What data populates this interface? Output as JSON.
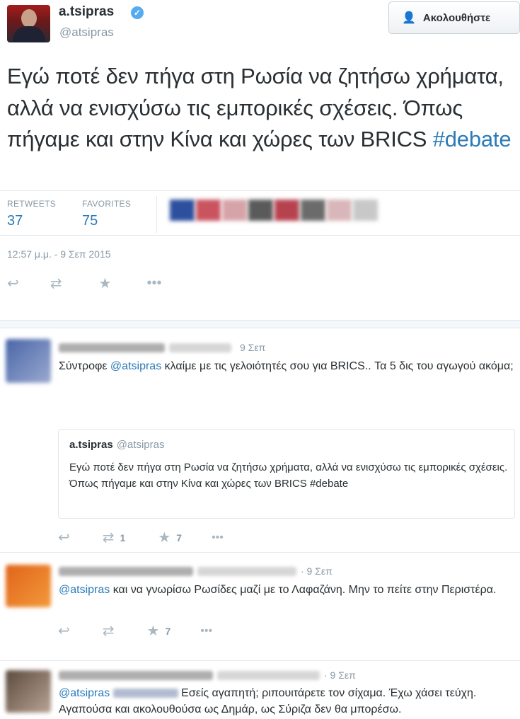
{
  "main_tweet": {
    "display_name": "a.tsipras",
    "screen_name": "@atsipras",
    "follow_label": "Ακολουθήστε",
    "text": "Εγώ ποτέ δεν πήγα στη Ρωσία να ζητήσω χρήματα, αλλά να ενισχύσω τις εμπορικές σχέσεις. Όπως πήγαμε και στην Κίνα και χώρες των BRICS",
    "hashtag": "#debate",
    "retweets_label": "RETWEETS",
    "retweets_count": "37",
    "favorites_label": "FAVORITES",
    "favorites_count": "75",
    "timestamp": "12:57 μ.μ. - 9 Σεπ 2015",
    "icons": {
      "reply": "reply-icon",
      "retweet": "retweet-icon",
      "favorite": "star-icon",
      "more": "more-icon"
    }
  },
  "replies": [
    {
      "time": "9 Σεπ",
      "mention": "@atsipras",
      "text_before": "Σύντροφε ",
      "text_after": " κλαίμε με τις γελοιότητές σου για BRICS.. Τα 5 δις του αγωγού ακόμα;",
      "quote": {
        "display_name": "a.tsipras",
        "screen_name": "@atsipras",
        "text": "Εγώ ποτέ δεν πήγα στη Ρωσία να ζητήσω χρήματα, αλλά να ενισχύσω τις εμπορικές σχέσεις. Όπως πήγαμε και στην Κίνα και χώρες των BRICS #debate"
      },
      "retweet_count": "1",
      "favorite_count": "7"
    },
    {
      "time": "· 9 Σεπ",
      "mention": "@atsipras",
      "text_after": " και να γνωρίσω Ρωσίδες μαζί με το Λαφαζάνη. Μην το πείτε στην Περιστέρα.",
      "favorite_count": "7"
    },
    {
      "time": "· 9 Σεπ",
      "mention": "@atsipras",
      "text_after": " Εσείς αγαπητή; ριπουιτάρετε τον σίχαμα. Έχω χάσει τεύχη. Αγαπούσα και ακολουθούσα ως Δημάρ, ως Σύριζα δεν θα μπορέσω."
    }
  ],
  "colors": {
    "link": "#2b7bb9",
    "muted": "#8899a6",
    "icon": "#aab8c2",
    "verified": "#55acee"
  }
}
